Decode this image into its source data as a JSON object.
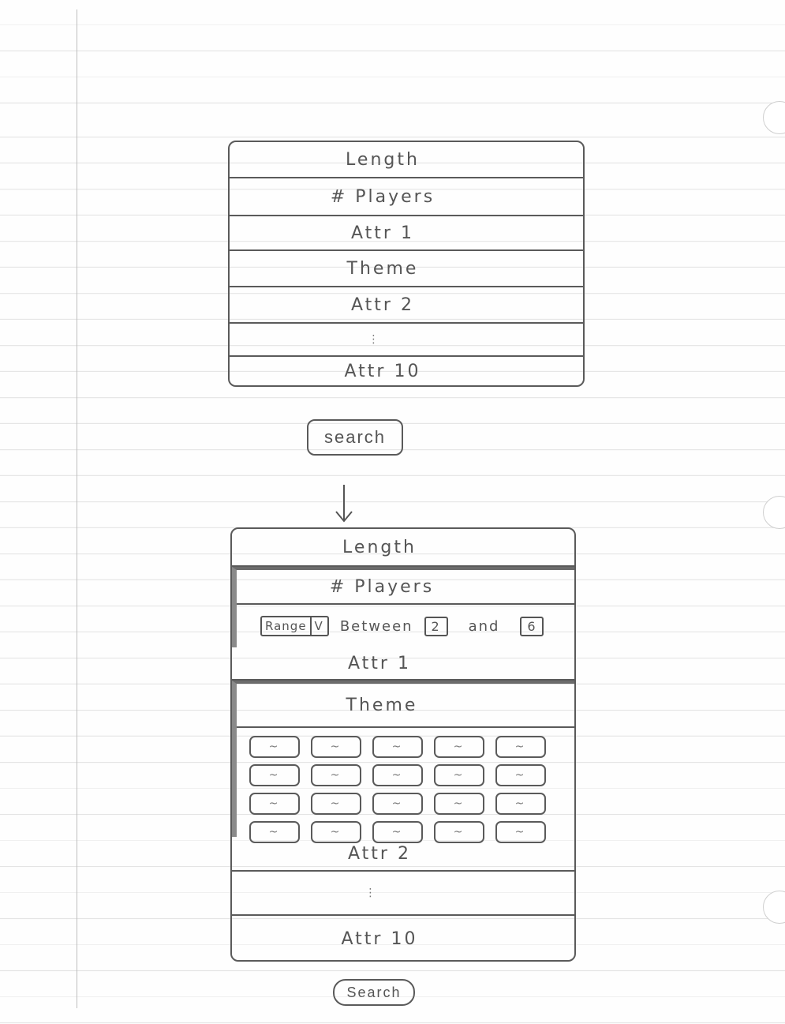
{
  "sketch": {
    "top_panel": {
      "rows": [
        {
          "label": "Length"
        },
        {
          "label": "# Players"
        },
        {
          "label": "Attr 1"
        },
        {
          "label": "Theme"
        },
        {
          "label": "Attr 2"
        },
        {
          "label": "⋮"
        },
        {
          "label": "Attr 10"
        }
      ],
      "search_label": "search"
    },
    "transition_arrow": "down-arrow",
    "bottom_panel": {
      "length_label": "Length",
      "players_label": "# Players",
      "players_filter": {
        "mode_value": "Range",
        "mode_chevron": "V",
        "between_label": "Between",
        "min_value": "2",
        "and_label": "and",
        "max_value": "6"
      },
      "attr1_label": "Attr 1",
      "theme_label": "Theme",
      "theme_chips": [
        "~",
        "~",
        "~",
        "~",
        "~",
        "~",
        "~",
        "~",
        "~",
        "~",
        "~",
        "~",
        "~",
        "~",
        "~",
        "~",
        "~",
        "~",
        "~",
        "~"
      ],
      "attr2_label": "Attr 2",
      "ellipsis": "⋮",
      "attr10_label": "Attr 10",
      "search_label": "Search"
    }
  }
}
